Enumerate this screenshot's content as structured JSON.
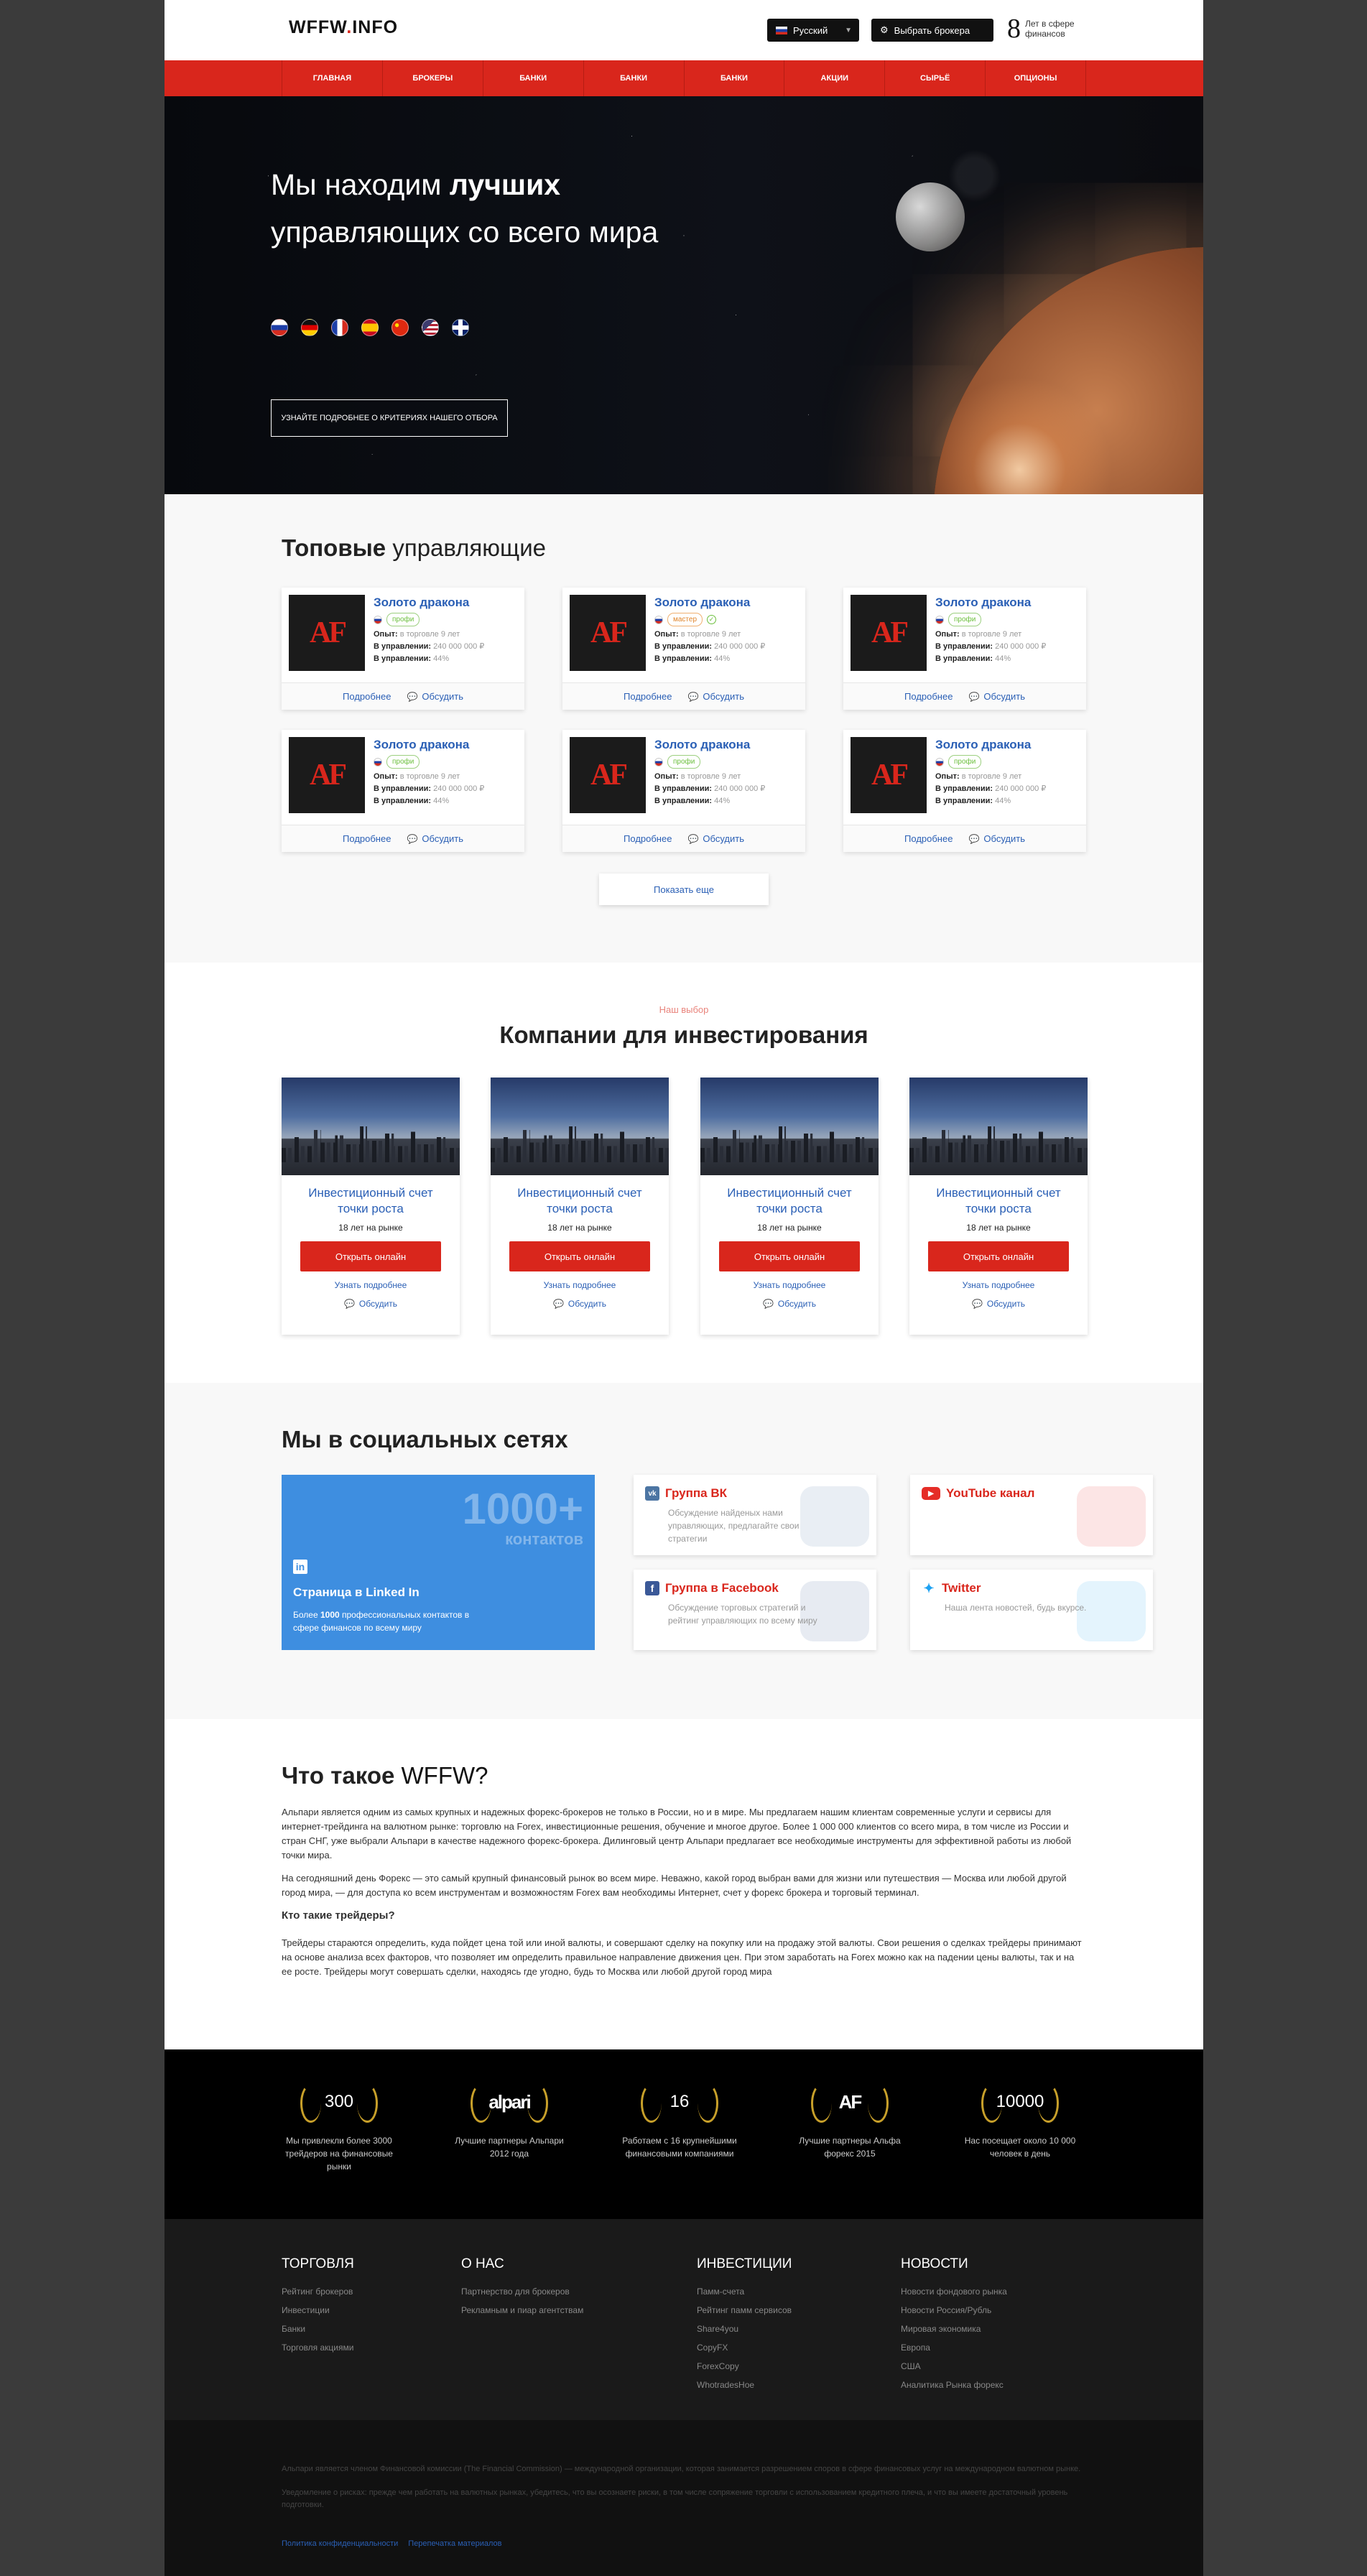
{
  "header": {
    "logo_main": "WFFW",
    "logo_sep": ".",
    "logo_tail": "INFO",
    "lang_label": "Русский",
    "broker_button": "Выбрать брокера",
    "years_num": "8",
    "years_text": "Лет в сфере финансов"
  },
  "nav": [
    "Главная",
    "Брокеры",
    "Банки",
    "Банки",
    "Банки",
    "Акции",
    "Сырьё",
    "Опционы"
  ],
  "hero": {
    "title_part1": "Мы находим ",
    "title_bold": "лучших",
    "title_part2": " управляющих со всего мира",
    "button": "Узнайте подробнее о критериях нашего отбора"
  },
  "managers": {
    "title_bold": "Топовые",
    "title_rest": " управляющие",
    "name": "Золото дракона",
    "exp_label": "Опыт:",
    "exp_value": "в торговле 9 лет",
    "aum_label": "В управлении:",
    "aum_value": "240 000 000 ₽",
    "ret_label": "В управлении:",
    "ret_value": "44%",
    "more_link": "Подробнее",
    "discuss_link": "Обсудить",
    "badges": [
      "профи",
      "мастер",
      "профи",
      "профи",
      "профи",
      "профи"
    ],
    "show_more": "Показать еще"
  },
  "invest": {
    "choice": "Наш выбор",
    "title_rest": "Компании ",
    "title_bold": "для инвестирования",
    "card_name": "Инвестиционный счет точки роста",
    "card_sub": "18 лет на рынке",
    "card_button": "Открыть онлайн",
    "card_more": "Узнать подробнее",
    "card_discuss": "Обсудить"
  },
  "social": {
    "title": "Мы в социальных сетях",
    "linkedin_big": "1000+",
    "linkedin_big_sub": "контактов",
    "linkedin_title": "Страница в Linked In",
    "linkedin_desc_pre": "Более ",
    "linkedin_desc_num": "1000",
    "linkedin_desc_post": " профессиональных контактов в сфере финансов по всему миру",
    "vk_title": "Группа ВК",
    "vk_desc": "Обсуждение найденых нами управляющих, предлагайте свои стратегии",
    "yt_title": "YouTube канал",
    "fb_title": "Группа в Facebook",
    "fb_desc": "Обсуждение торговых стратегий и рейтинг управляющих по всему миру",
    "tw_title": "Twitter",
    "tw_desc": "Наша лента новостей, будь вкурсе."
  },
  "about": {
    "title_pre": "Что такое ",
    "title_main": "WFFW?",
    "p1": "Альпари является одним из самых крупных и надежных форекс-брокеров не только в России, но и в мире. Мы предлагаем нашим клиентам современные услуги и сервисы для интернет-трейдинга на валютном рынке: торговлю на Forex, инвестиционные решения, обучение и многое другое. Более 1 000 000 клиентов со всего мира, в том числе из России и стран СНГ, уже выбрали Альпари в качестве надежного форекс-брокера. Дилинговый центр Альпари предлагает все необходимые инструменты для эффективной работы из любой точки мира.",
    "p2": "На сегодняшний день Форекс — это самый крупный финансовый рынок во всем мире. Неважно, какой город выбран вами для жизни или путешествия — Москва или любой другой город мира, — для доступа ко всем инструментам и возможностям Forex вам необходимы Интернет, счет у форекс брокера и торговый терминал.",
    "h": "Кто такие трейдеры?",
    "p3": "Трейдеры стараются определить, куда пойдет цена той или иной валюты, и совершают сделку на покупку или на продажу этой валюты. Свои решения о сделках трейдеры принимают на основе анализа всех факторов, что позволяет им определить правильное направление движения цен. При этом заработать на Forex можно как на падении цены валюты, так и на ее росте. Трейдеры могут совершать сделки, находясь где угодно, будь то Москва или любой другой город мира"
  },
  "awards": [
    {
      "mark": "300",
      "text": "Мы привлекли более 3000 трейдеров на финансовые рынки"
    },
    {
      "mark": "alpari",
      "text": "Лучшие партнеры Альпари 2012 года"
    },
    {
      "mark": "16",
      "text": "Работаем с 16 крупнейшими финансовыми компаниями"
    },
    {
      "mark": "AF",
      "text": "Лучшие партнеры Альфа форекс 2015"
    },
    {
      "mark": "10000",
      "text": "Нас посещает около 10 000 человек в день"
    }
  ],
  "footer": {
    "col1_title": "Торговля",
    "col1": [
      "Рейтинг брокеров",
      "Инвестиции",
      "Банки",
      "Торговля акциями"
    ],
    "col2_title": "О нас",
    "col2": [
      "Партнерство для брокеров",
      "Рекламным и пиар агентствам"
    ],
    "col3_title": "Инвестиции",
    "col3": [
      "Памм-счета",
      "Рейтинг памм сервисов",
      "Share4you",
      "CopyFX",
      "ForexCopy",
      "WhotradesHoe"
    ],
    "col4_title": "Новости",
    "col4": [
      "Новости фондового рынка",
      "Новости Россия/Рубль",
      "Мировая экономика",
      "Европа",
      "США",
      "Аналитика Рынка форекс"
    ],
    "disclaimer1": "Альпари является членом Финансовой комиссии (The Financial Commission) — международной организации, которая занимается разрешением споров в сфере финансовых услуг на международном валютном рынке.",
    "disclaimer2": "Уведомление о рисках: прежде чем работать на валютных рынках, убедитесь, что вы осознаете риски, в том числе сопряжение торговли с использованием кредитного плеча, и что вы имеете достаточный уровень подготовки.",
    "link1": "Политика конфиденциальности",
    "link2": "Перепечатка материалов"
  }
}
